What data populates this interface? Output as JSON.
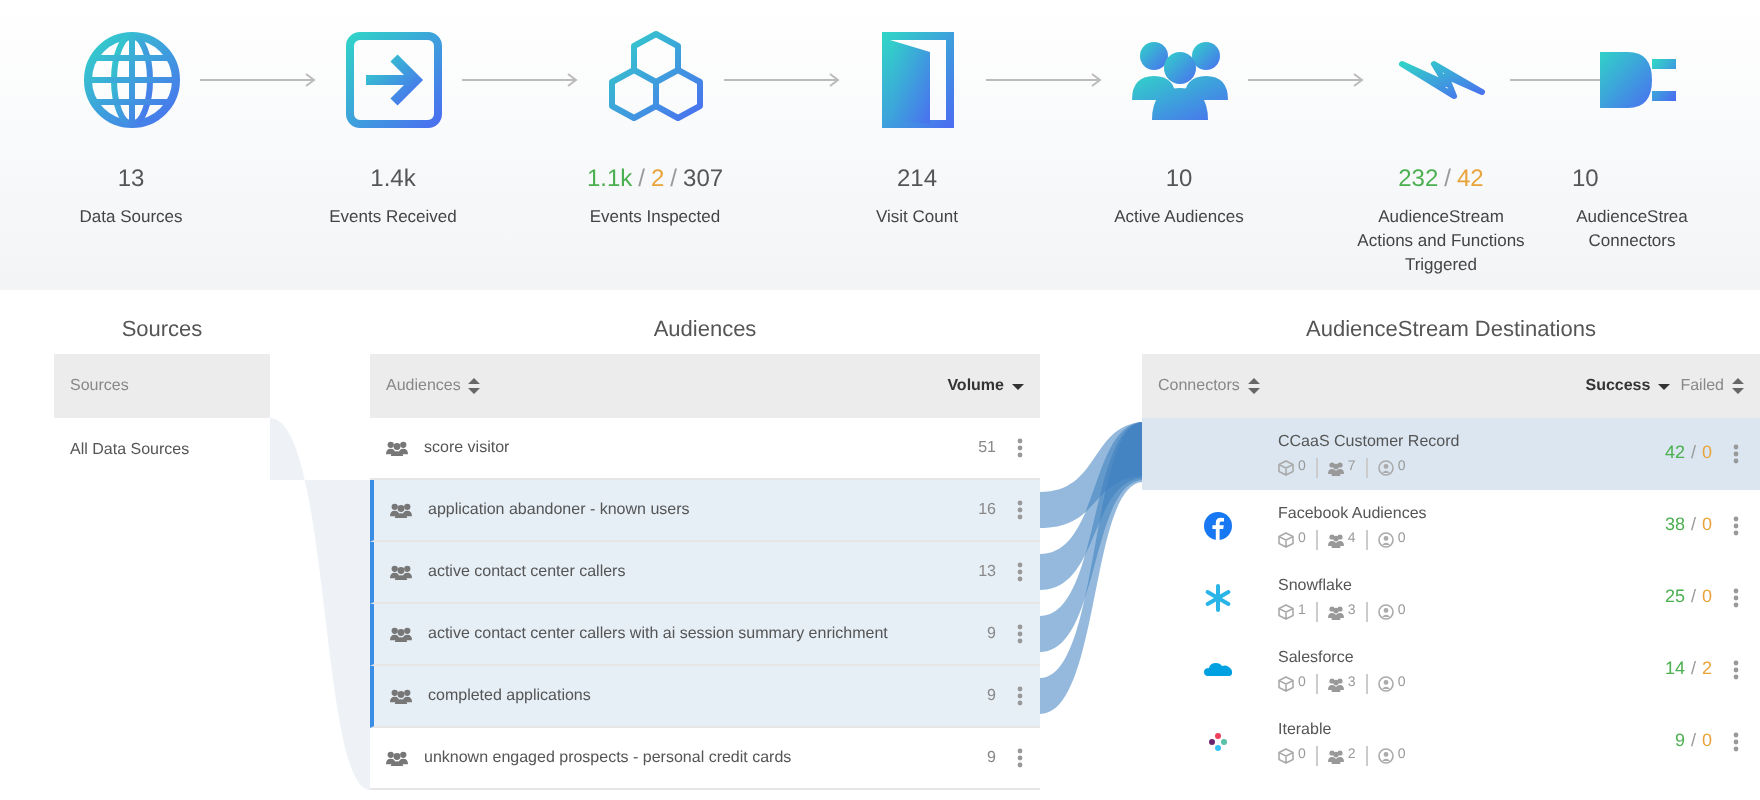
{
  "steps": [
    {
      "value": [
        {
          "text": "13",
          "kind": "total"
        }
      ],
      "label": "Data Sources"
    },
    {
      "value": [
        {
          "text": "1.4k",
          "kind": "total"
        }
      ],
      "label": "Events Received"
    },
    {
      "value": [
        {
          "text": "1.1k",
          "kind": "success"
        },
        {
          "text": "/",
          "kind": "separator"
        },
        {
          "text": "2",
          "kind": "warning"
        },
        {
          "text": "/",
          "kind": "separator"
        },
        {
          "text": "307",
          "kind": "total"
        }
      ],
      "label": "Events Inspected"
    },
    {
      "value": [
        {
          "text": "214",
          "kind": "total"
        }
      ],
      "label": "Visit Count"
    },
    {
      "value": [
        {
          "text": "10",
          "kind": "total"
        }
      ],
      "label": "Active Audiences"
    },
    {
      "value": [
        {
          "text": "232",
          "kind": "success"
        },
        {
          "text": "/",
          "kind": "separator"
        },
        {
          "text": "42",
          "kind": "warning"
        }
      ],
      "label": "AudienceStream Actions and Functions Triggered"
    },
    {
      "value": [
        {
          "text": "10",
          "kind": "total"
        }
      ],
      "label": "AudienceStrea Connectors"
    }
  ],
  "sources": {
    "title": "Sources",
    "column": "Sources",
    "rows": [
      {
        "name": "All Data Sources"
      }
    ]
  },
  "audiences": {
    "title": "Audiences",
    "columns": [
      {
        "label": "Audiences"
      },
      {
        "label": "Volume"
      }
    ],
    "rows": [
      {
        "name": "score visitor",
        "volume": "51",
        "selected": false
      },
      {
        "name": "application abandoner - known users",
        "volume": "16",
        "selected": true
      },
      {
        "name": "active contact center callers",
        "volume": "13",
        "selected": true
      },
      {
        "name": "active contact center callers with ai session summary enrichment",
        "volume": "9",
        "selected": true
      },
      {
        "name": "completed applications",
        "volume": "9",
        "selected": true
      },
      {
        "name": "unknown engaged prospects - personal credit cards",
        "volume": "9",
        "selected": false
      }
    ]
  },
  "destinations": {
    "title": "AudienceStream Destinations",
    "columns": [
      {
        "label": "Connectors"
      },
      {
        "label": "Success"
      },
      {
        "label": "Failed"
      }
    ],
    "rows": [
      {
        "name": "CCaaS Customer Record",
        "events": "0",
        "audiences": "7",
        "visitors": "0",
        "result": [
          {
            "text": "42",
            "kind": "success"
          },
          {
            "text": "/",
            "kind": "separator"
          },
          {
            "text": "0",
            "kind": "warning"
          }
        ],
        "selected": true
      },
      {
        "name": "Facebook Audiences",
        "events": "0",
        "audiences": "4",
        "visitors": "0",
        "result": [
          {
            "text": "38",
            "kind": "success"
          },
          {
            "text": "/",
            "kind": "separator"
          },
          {
            "text": "0",
            "kind": "warning"
          }
        ],
        "selected": false
      },
      {
        "name": "Snowflake",
        "events": "1",
        "audiences": "3",
        "visitors": "0",
        "result": [
          {
            "text": "25",
            "kind": "success"
          },
          {
            "text": "/",
            "kind": "separator"
          },
          {
            "text": "0",
            "kind": "warning"
          }
        ],
        "selected": false
      },
      {
        "name": "Salesforce",
        "events": "0",
        "audiences": "3",
        "visitors": "0",
        "result": [
          {
            "text": "14",
            "kind": "success"
          },
          {
            "text": "/",
            "kind": "separator"
          },
          {
            "text": "2",
            "kind": "warning"
          }
        ],
        "selected": false
      },
      {
        "name": "Iterable",
        "events": "0",
        "audiences": "2",
        "visitors": "0",
        "result": [
          {
            "text": "9",
            "kind": "success"
          },
          {
            "text": "/",
            "kind": "separator"
          },
          {
            "text": "0",
            "kind": "warning"
          }
        ],
        "selected": false
      }
    ]
  }
}
